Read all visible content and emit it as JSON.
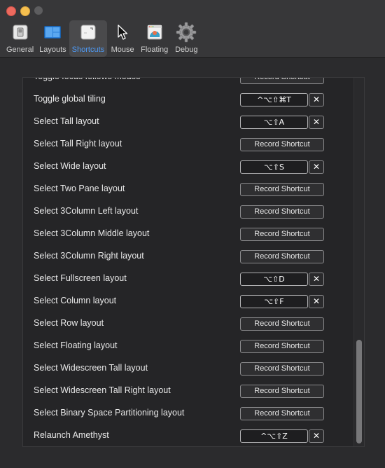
{
  "toolbar": {
    "items": [
      {
        "label": "General",
        "icon": "switch-icon"
      },
      {
        "label": "Layouts",
        "icon": "layouts-icon"
      },
      {
        "label": "Shortcuts",
        "icon": "keyboard-icon"
      },
      {
        "label": "Mouse",
        "icon": "cursor-icon"
      },
      {
        "label": "Floating",
        "icon": "floating-app-icon"
      },
      {
        "label": "Debug",
        "icon": "gear-icon"
      }
    ],
    "selected": "Shortcuts"
  },
  "shortcuts": [
    {
      "label": "Toggle focus follows mouse",
      "key": null
    },
    {
      "label": "Toggle global tiling",
      "key": "^⌥⇧⌘T"
    },
    {
      "label": "Select Tall layout",
      "key": "⌥⇧A"
    },
    {
      "label": "Select Tall Right layout",
      "key": null
    },
    {
      "label": "Select Wide layout",
      "key": "⌥⇧S"
    },
    {
      "label": "Select Two Pane layout",
      "key": null
    },
    {
      "label": "Select 3Column Left layout",
      "key": null
    },
    {
      "label": "Select 3Column Middle layout",
      "key": null
    },
    {
      "label": "Select 3Column Right layout",
      "key": null
    },
    {
      "label": "Select Fullscreen layout",
      "key": "⌥⇧D"
    },
    {
      "label": "Select Column layout",
      "key": "⌥⇧F"
    },
    {
      "label": "Select Row layout",
      "key": null
    },
    {
      "label": "Select Floating layout",
      "key": null
    },
    {
      "label": "Select Widescreen Tall layout",
      "key": null
    },
    {
      "label": "Select Widescreen Tall Right layout",
      "key": null
    },
    {
      "label": "Select Binary Space Partitioning layout",
      "key": null
    },
    {
      "label": "Relaunch Amethyst",
      "key": "^⌥⇧Z"
    }
  ],
  "record_label": "Record Shortcut",
  "clear_glyph": "✕",
  "colors": {
    "selected_tab_text": "#4e9bf7",
    "close": "#ed6a5e",
    "minimize": "#f5bf4f",
    "zoom_disabled": "#5d5d5f"
  }
}
